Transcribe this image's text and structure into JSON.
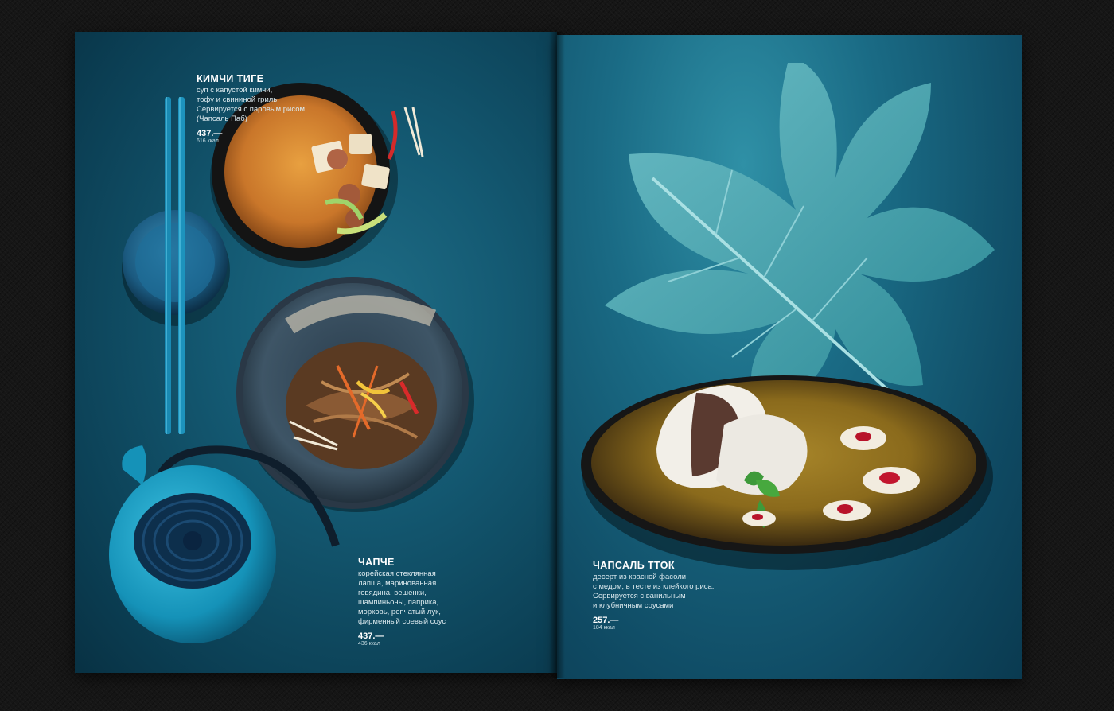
{
  "dishes": [
    {
      "name": "КИМЧИ ТИГЕ",
      "description": "суп с капустой кимчи,\nтофу и свининой гриль.\nСервируется с паровым рисом\n(Чапсаль Паб)",
      "price": "437.—",
      "kcal": "616 ккал"
    },
    {
      "name": "ЧАПЧЕ",
      "description": "корейская стеклянная\nлапша, маринованная\nговядина, вешенки,\nшампиньоны, паприка,\nморковь, репчатый лук,\nфирменный соевый соус",
      "price": "437.—",
      "kcal": "436 ккал"
    },
    {
      "name": "ЧАПСАЛЬ ТТОК",
      "description": "десерт из красной фасоли\nс медом, в тесте из клейкого риса.\nСервируется с ванильным\nи клубничным соусами",
      "price": "257.—",
      "kcal": "184 ккал"
    }
  ],
  "colors": {
    "page_teal": "#145a73",
    "background": "#161616",
    "text": "#e8f2f5"
  }
}
